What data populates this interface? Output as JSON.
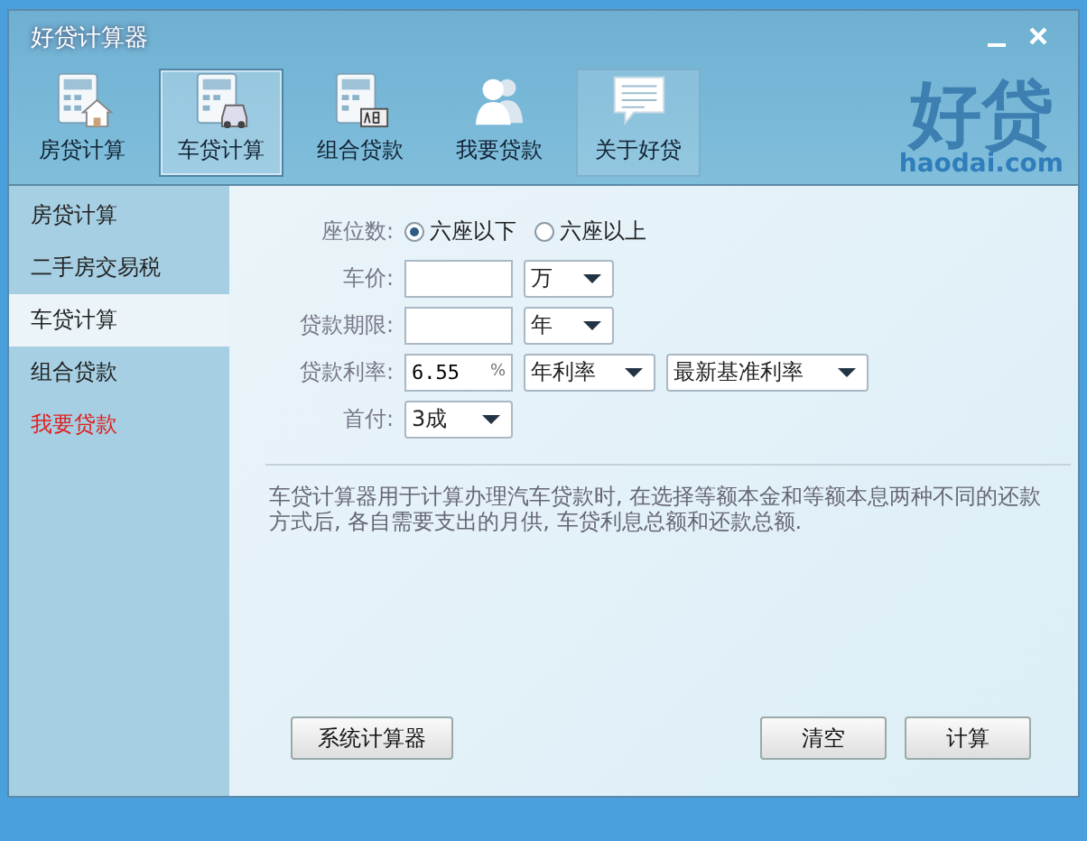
{
  "window": {
    "title": "好贷计算器"
  },
  "toolbar": [
    {
      "label": "房贷计算",
      "selected": false,
      "hovered": false
    },
    {
      "label": "车贷计算",
      "selected": true,
      "hovered": false
    },
    {
      "label": "组合贷款",
      "selected": false,
      "hovered": false
    },
    {
      "label": "我要贷款",
      "selected": false,
      "hovered": false
    },
    {
      "label": "关于好贷",
      "selected": false,
      "hovered": true
    }
  ],
  "logo": {
    "name": "好贷",
    "domain": "haodai.com"
  },
  "sidebar": {
    "items": [
      {
        "label": "房贷计算",
        "selected": false,
        "emphasized": false
      },
      {
        "label": "二手房交易税",
        "selected": false,
        "emphasized": false
      },
      {
        "label": "车贷计算",
        "selected": true,
        "emphasized": false
      },
      {
        "label": "组合贷款",
        "selected": false,
        "emphasized": false
      },
      {
        "label": "我要贷款",
        "selected": false,
        "emphasized": true
      }
    ]
  },
  "form": [
    {
      "label": "座位数:",
      "kind": "radio",
      "options": [
        {
          "label": "六座以下",
          "selected": true
        },
        {
          "label": "六座以上",
          "selected": false
        }
      ]
    },
    {
      "label": "车价:",
      "kind": "fields",
      "controls": [
        {
          "kind": "input"
        },
        {
          "kind": "select",
          "value": "万"
        }
      ]
    },
    {
      "label": "贷款期限:",
      "kind": "fields",
      "controls": [
        {
          "kind": "input"
        },
        {
          "kind": "select",
          "value": "年"
        }
      ]
    },
    {
      "label": "贷款利率:",
      "kind": "fields",
      "controls": [
        {
          "kind": "input",
          "value": "6.55",
          "suffix": "%"
        },
        {
          "kind": "select",
          "value": "年利率"
        },
        {
          "kind": "select",
          "value": "最新基准利率"
        }
      ]
    },
    {
      "label": "首付:",
      "kind": "fields",
      "controls": [
        {
          "kind": "select",
          "value": "3成"
        }
      ]
    }
  ],
  "description": "车贷计算器用于计算办理汽车贷款时, 在选择等额本金和等额本息两种不同的还款方式后, 各自需要支出的月供, 车贷利息总额和还款总额.",
  "buttons": {
    "left": [
      "系统计算器"
    ],
    "right": [
      "清空",
      "计算"
    ]
  }
}
